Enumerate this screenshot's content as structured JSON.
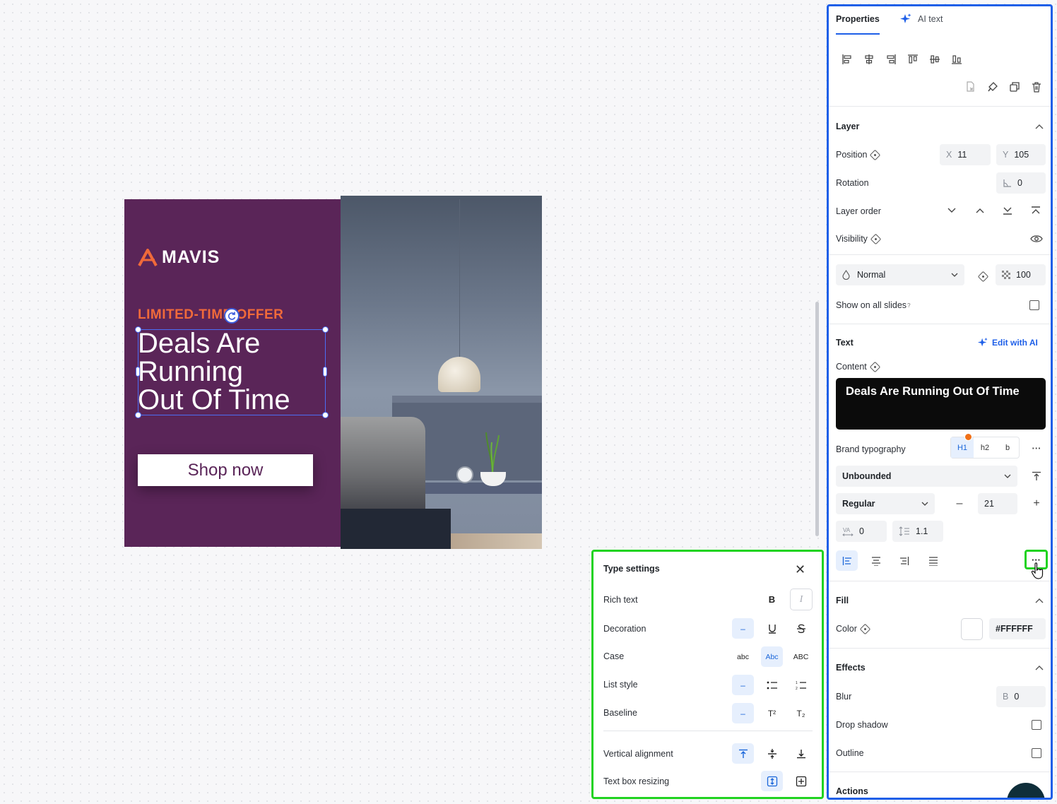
{
  "banner": {
    "logo_text": "MAVIS",
    "offer_text": "LIMITED-TIME OFFER",
    "headline_lines": [
      "Deals Are",
      "Running",
      "Out Of Time"
    ],
    "cta_label": "Shop now"
  },
  "type_settings": {
    "title": "Type settings",
    "rows": {
      "rich_text": "Rich text",
      "decoration": "Decoration",
      "case": "Case",
      "list_style": "List style",
      "baseline": "Baseline",
      "vertical_alignment": "Vertical alignment",
      "text_box_resizing": "Text box resizing"
    },
    "bold_glyph": "B",
    "italic_glyph": "I",
    "case_options": [
      "abc",
      "Abc",
      "ABC"
    ],
    "superscript_glyph": "T²",
    "subscript_glyph": "T₂"
  },
  "properties": {
    "tabs": [
      "Properties",
      "AI text"
    ],
    "layer": {
      "title": "Layer",
      "position_label": "Position",
      "x_prefix": "X",
      "x_value": "11",
      "y_prefix": "Y",
      "y_value": "105",
      "rotation_label": "Rotation",
      "rotation_value": "0",
      "layer_order_label": "Layer order",
      "visibility_label": "Visibility"
    },
    "blend": {
      "mode": "Normal",
      "opacity": "100",
      "show_on_all_slides": "Show on all slides",
      "show_on_all_slides_sup": "?"
    },
    "text": {
      "title": "Text",
      "edit_with_ai": "Edit with AI",
      "content_label": "Content",
      "content_value": "Deals Are Running Out Of Time",
      "brand_typography_label": "Brand typography",
      "typography_options": [
        "H1",
        "h2",
        "b"
      ],
      "box_mode": "Unbounded",
      "font_weight": "Regular",
      "font_size": "21",
      "letter_spacing": "0",
      "line_height": "1.1"
    },
    "fill": {
      "title": "Fill",
      "color_label": "Color",
      "color_value": "#FFFFFF"
    },
    "effects": {
      "title": "Effects",
      "blur_label": "Blur",
      "blur_prefix": "B",
      "blur_value": "0",
      "drop_shadow_label": "Drop shadow",
      "outline_label": "Outline"
    },
    "actions": {
      "title": "Actions"
    }
  },
  "colors": {
    "banner_purple": "#5a2558",
    "offer_orange": "#f06a3a",
    "accent_blue": "#1e5fe8",
    "highlight_green": "#21d321"
  }
}
